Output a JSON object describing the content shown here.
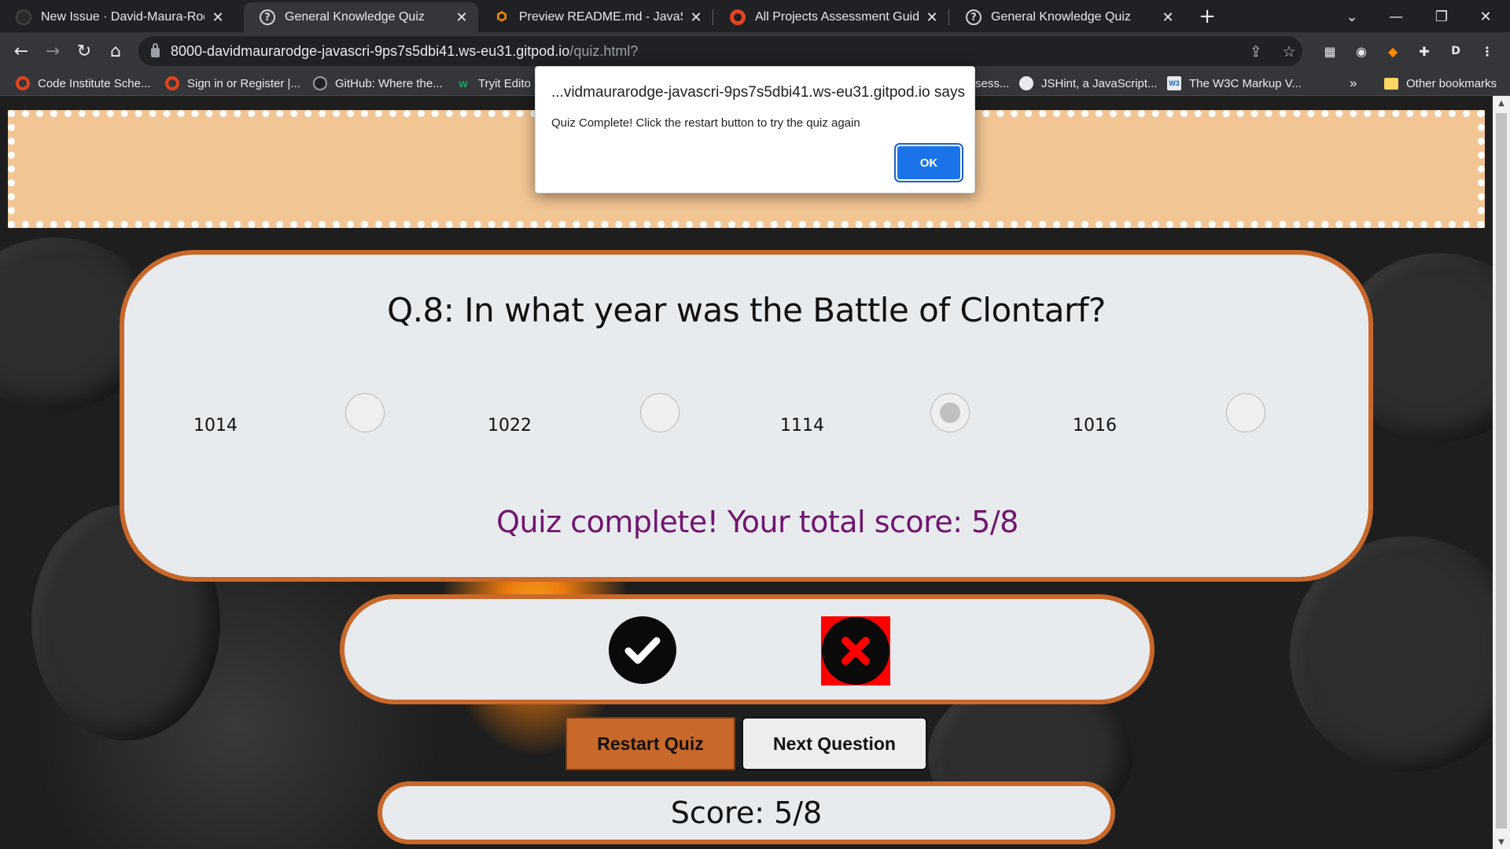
{
  "browser": {
    "tabs": [
      {
        "title": "New Issue · David-Maura-Rodger",
        "favicon": "github-icon"
      },
      {
        "title": "General Knowledge Quiz",
        "favicon": "question-circle-icon",
        "active": true
      },
      {
        "title": "Preview README.md - JavaScript",
        "favicon": "gitpod-icon"
      },
      {
        "title": "All Projects Assessment Guide | A",
        "favicon": "code-institute-icon"
      },
      {
        "title": "General Knowledge Quiz",
        "favicon": "question-circle-icon"
      }
    ],
    "url_main": "8000-davidmaurarodge-javascri-9ps7s5dbi41.ws-eu31.gitpod.io",
    "url_path": "/quiz.html?",
    "profile_initial": "D",
    "bookmarks": [
      {
        "label": "Code Institute Sche...",
        "icon": "code-institute-icon"
      },
      {
        "label": "Sign in or Register |...",
        "icon": "code-institute-icon"
      },
      {
        "label": "GitHub: Where the...",
        "icon": "github-icon"
      },
      {
        "label": "Tryit Edito",
        "icon": "w3schools-icon"
      },
      {
        "label": "sess...",
        "icon": ""
      },
      {
        "label": "JSHint, a JavaScript...",
        "icon": "globe-icon"
      },
      {
        "label": "The W3C Markup V...",
        "icon": "w3c-icon"
      }
    ],
    "bookmarks_overflow": "»",
    "other_bookmarks": "Other bookmarks"
  },
  "dialog": {
    "title": "...vidmaurarodge-javascri-9ps7s5dbi41.ws-eu31.gitpod.io says",
    "message": "Quiz Complete! Click the restart button to try the quiz again",
    "ok_label": "OK"
  },
  "quiz": {
    "question": "Q.8: In what year was the Battle of Clontarf?",
    "options": [
      {
        "label": "1014",
        "selected": false
      },
      {
        "label": "1022",
        "selected": false
      },
      {
        "label": "1114",
        "selected": true
      },
      {
        "label": "1016",
        "selected": false
      }
    ],
    "final_message": "Quiz complete! Your total score: 5/8",
    "feedback": {
      "correct_icon": "check-circle-icon",
      "incorrect_icon": "x-circle-icon"
    },
    "restart_label": "Restart Quiz",
    "next_label": "Next Question",
    "score_text": "Score: 5/8"
  },
  "colors": {
    "accent_orange": "#c8682a",
    "header_band": "#f2c594",
    "final_message": "#70156f",
    "incorrect_bg": "#ff0000",
    "dialog_ok": "#1a73e8"
  }
}
